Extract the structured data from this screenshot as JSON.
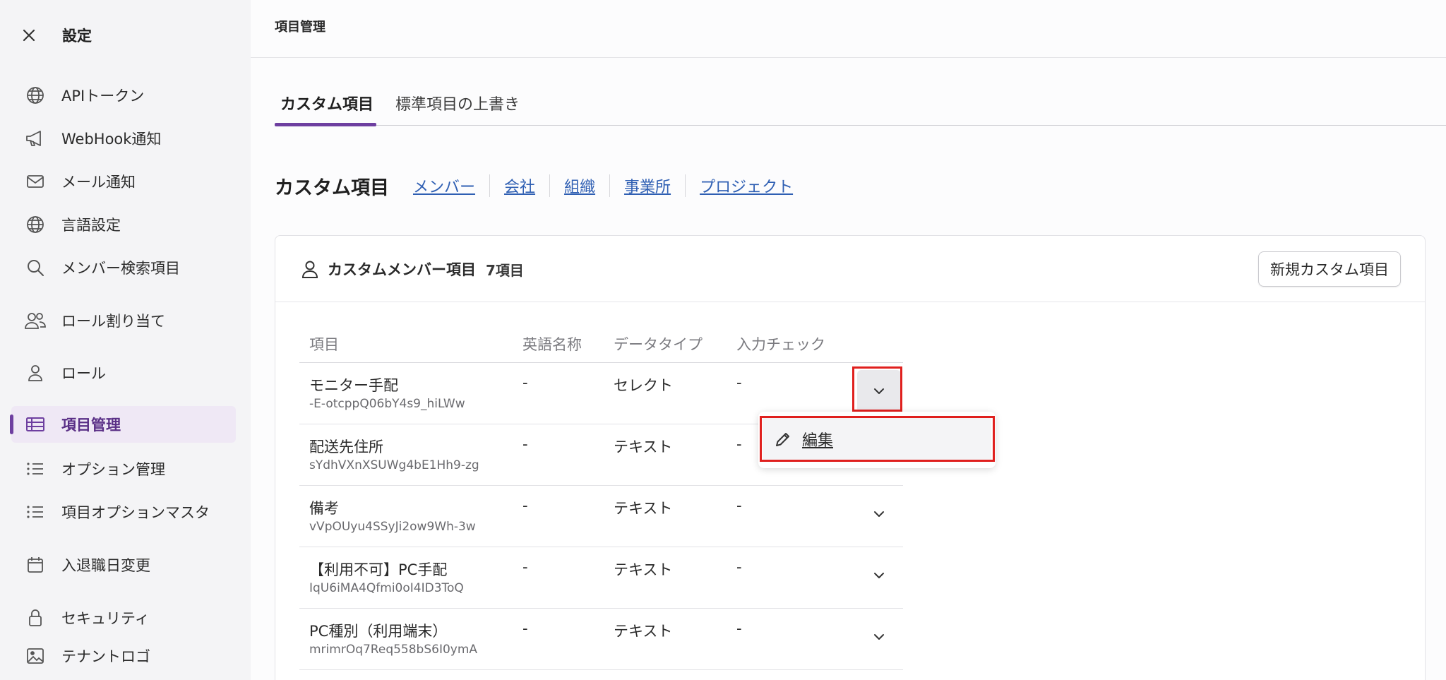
{
  "sidebar": {
    "title": "設定",
    "items": [
      {
        "label": "APIトークン",
        "icon": "globe-icon"
      },
      {
        "label": "WebHook通知",
        "icon": "megaphone-icon"
      },
      {
        "label": "メール通知",
        "icon": "mail-icon"
      },
      {
        "label": "言語設定",
        "icon": "globe-icon"
      },
      {
        "label": "メンバー検索項目",
        "icon": "search-icon"
      },
      {
        "label": "ロール割り当て",
        "icon": "users-icon"
      },
      {
        "label": "ロール",
        "icon": "user-icon"
      },
      {
        "label": "項目管理",
        "icon": "table-icon",
        "active": true
      },
      {
        "label": "オプション管理",
        "icon": "list-icon"
      },
      {
        "label": "項目オプションマスタ",
        "icon": "list-icon"
      },
      {
        "label": "入退職日変更",
        "icon": "calendar-icon"
      },
      {
        "label": "セキュリティ",
        "icon": "lock-icon"
      },
      {
        "label": "テナントロゴ",
        "icon": "image-icon"
      }
    ]
  },
  "header": {
    "title": "項目管理"
  },
  "tabs": [
    {
      "label": "カスタム項目",
      "active": true
    },
    {
      "label": "標準項目の上書き"
    }
  ],
  "section": {
    "title": "カスタム項目",
    "links": [
      "メンバー",
      "会社",
      "組織",
      "事業所",
      "プロジェクト"
    ]
  },
  "card": {
    "title": "カスタムメンバー項目",
    "count": "7項目",
    "new_button": "新規カスタム項目",
    "columns": [
      "項目",
      "英語名称",
      "データタイプ",
      "入力チェック"
    ],
    "rows": [
      {
        "name": "モニター手配",
        "id": "-E-otcppQ06bY4s9_hiLWw",
        "english": "-",
        "type": "セレクト",
        "check": "-"
      },
      {
        "name": "配送先住所",
        "id": "sYdhVXnXSUWg4bE1Hh9-zg",
        "english": "-",
        "type": "テキスト",
        "check": "-"
      },
      {
        "name": "備考",
        "id": "vVpOUyu4SSyJi2ow9Wh-3w",
        "english": "-",
        "type": "テキスト",
        "check": "-"
      },
      {
        "name": "【利用不可】PC手配",
        "id": "IqU6iMA4Qfmi0oI4ID3ToQ",
        "english": "-",
        "type": "テキスト",
        "check": "-"
      },
      {
        "name": "PC種別（利用端末）",
        "id": "mrimrOq7Req558bS6I0ymA",
        "english": "-",
        "type": "テキスト",
        "check": "-"
      }
    ]
  },
  "dropdown": {
    "edit_label": "編集"
  },
  "colors": {
    "accent": "#6e3fa0",
    "link": "#2f5fb3",
    "highlight": "#e0201e"
  }
}
